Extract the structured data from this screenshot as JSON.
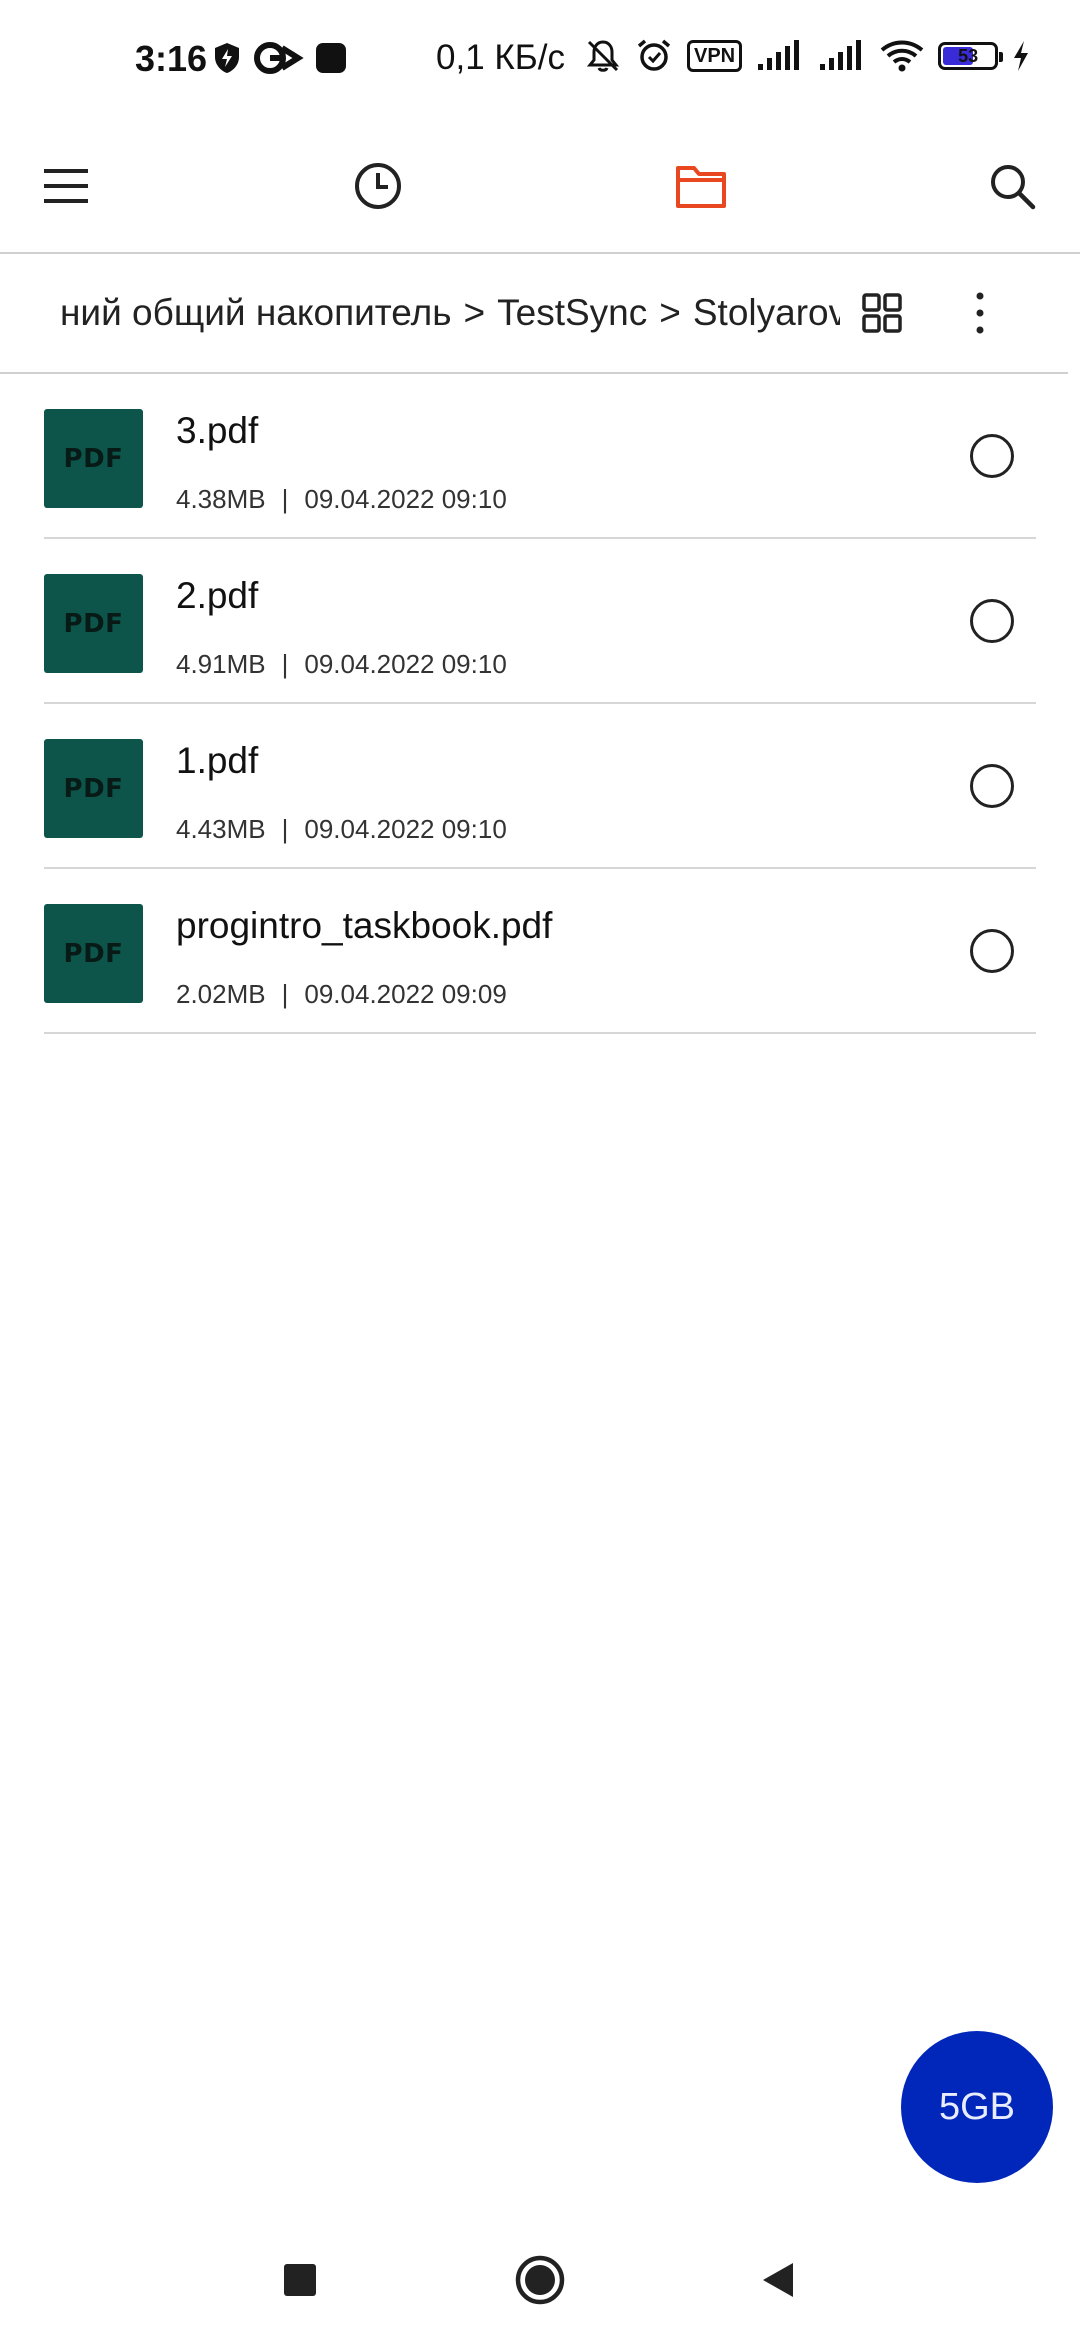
{
  "status_bar": {
    "time": "3:16",
    "speed": "0,1 КБ/с",
    "vpn": "VPN",
    "battery": "53",
    "icons": [
      "shield-icon",
      "g-app-icon",
      "app-square-icon",
      "mute-bell-icon",
      "alarm-icon",
      "vpn-icon",
      "signal-icon",
      "signal-icon",
      "wifi-icon",
      "battery-icon",
      "charging-icon"
    ]
  },
  "toolbar": {
    "icons": [
      "menu-icon",
      "recent-clock-icon",
      "folder-icon",
      "search-icon"
    ],
    "active_color": "#e8471f"
  },
  "breadcrumb": {
    "items": [
      "ний общий накопитель",
      "TestSync",
      "Stolyarov"
    ],
    "separator": ">",
    "actions": [
      "grid-view-icon",
      "more-vert-icon"
    ]
  },
  "files": [
    {
      "name": "3.pdf",
      "size": "4.38MB",
      "date": "09.04.2022 09:10",
      "thumb_label": "PDF"
    },
    {
      "name": "2.pdf",
      "size": "4.91MB",
      "date": "09.04.2022 09:10",
      "thumb_label": "PDF"
    },
    {
      "name": "1.pdf",
      "size": "4.43MB",
      "date": "09.04.2022 09:10",
      "thumb_label": "PDF"
    },
    {
      "name": "progintro_taskbook.pdf",
      "size": "2.02MB",
      "date": "09.04.2022 09:09",
      "thumb_label": "PDF"
    }
  ],
  "meta_separator": "|",
  "fab": {
    "label": "5GB",
    "color": "#0027b9"
  },
  "nav": {
    "icons": [
      "recents-square-icon",
      "home-circle-icon",
      "back-triangle-icon"
    ]
  }
}
